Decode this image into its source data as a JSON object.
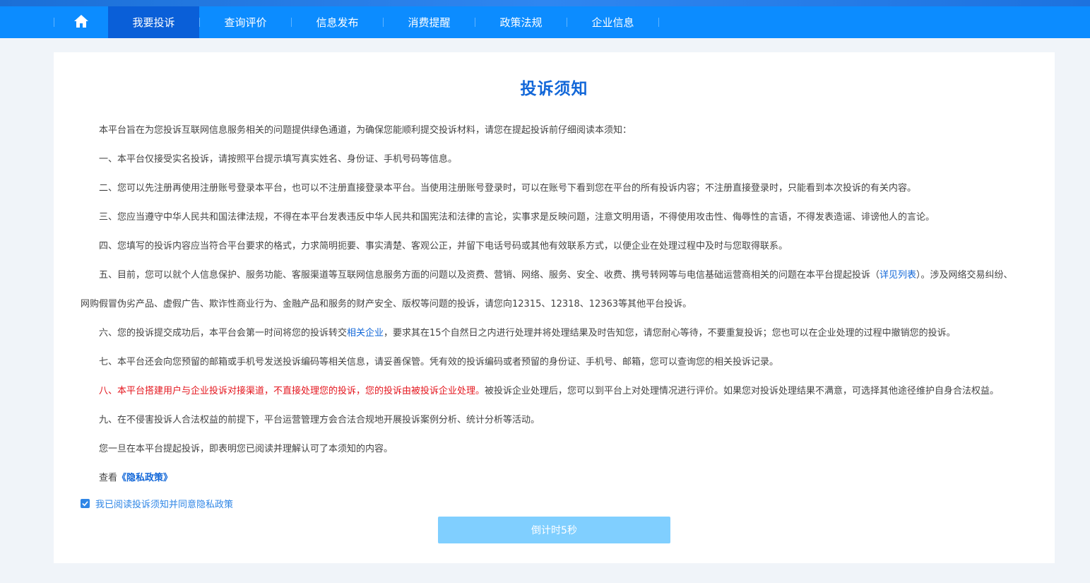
{
  "nav": {
    "home_icon": "home-icon",
    "items": [
      {
        "label": "我要投诉"
      },
      {
        "label": "查询评价"
      },
      {
        "label": "信息发布"
      },
      {
        "label": "消费提醒"
      },
      {
        "label": "政策法规"
      },
      {
        "label": "企业信息"
      }
    ]
  },
  "notice": {
    "title": "投诉须知",
    "intro": "本平台旨在为您投诉互联网信息服务相关的问题提供绿色通道，为确保您能顺利提交投诉材料，请您在提起投诉前仔细阅读本须知：",
    "p1": "一、本平台仅接受实名投诉，请按照平台提示填写真实姓名、身份证、手机号码等信息。",
    "p2": "二、您可以先注册再使用注册账号登录本平台，也可以不注册直接登录本平台。当使用注册账号登录时，可以在账号下看到您在平台的所有投诉内容；不注册直接登录时，只能看到本次投诉的有关内容。",
    "p3": "三、您应当遵守中华人民共和国法律法规，不得在本平台发表违反中华人民共和国宪法和法律的言论，实事求是反映问题，注意文明用语，不得使用攻击性、侮辱性的言语，不得发表造谣、诽谤他人的言论。",
    "p4": "四、您填写的投诉内容应当符合平台要求的格式，力求简明扼要、事实清楚、客观公正，并留下电话号码或其他有效联系方式，以便企业在处理过程中及时与您取得联系。",
    "p5_pre": "五、目前，您可以就个人信息保护、服务功能、客服渠道等互联网信息服务方面的问题以及资费、营销、网络、服务、安全、收费、携号转网等与电信基础运营商相关的问题在本平台提起投诉（",
    "p5_link": "详见列表",
    "p5_post": "）。涉及网络交易纠纷、",
    "p5_cont": "网购假冒伪劣产品、虚假广告、欺诈性商业行为、金融产品和服务的财产安全、版权等问题的投诉，请您向12315、12318、12363等其他平台投诉。",
    "p6_pre": "六、您的投诉提交成功后，本平台会第一时间将您的投诉转交",
    "p6_link": "相关企业",
    "p6_post": "，要求其在15个自然日之内进行处理并将处理结果及时告知您，请您耐心等待，不要重复投诉；您也可以在企业处理的过程中撤销您的投诉。",
    "p7": "七、本平台还会向您预留的邮箱或手机号发送投诉编码等相关信息，请妥善保管。凭有效的投诉编码或者预留的身份证、手机号、邮箱，您可以查询您的相关投诉记录。",
    "p8_pre": "八、",
    "p8_red": "本平台搭建用户与企业投诉对接渠道，不直接处理您的投诉，您的投诉由被投诉企业处理。",
    "p8_post": "被投诉企业处理后，您可以到平台上对处理情况进行评价。如果您对投诉处理结果不满意，可选择其他途径维护自身合法权益。",
    "p9": "九、在不侵害投诉人合法权益的前提下，平台运营管理方会合法合规地开展投诉案例分析、统计分析等活动。",
    "closing": "您一旦在本平台提起投诉，即表明您已阅读并理解认可了本须知的内容。",
    "privacy_pre": "查看",
    "privacy_link": "《隐私政策》"
  },
  "agree_label": "我已阅读投诉须知并同意隐私政策",
  "countdown_button": "倒计时5秒",
  "colors": {
    "nav_bg": "#0c8cff",
    "nav_active": "#0a5fd8",
    "accent": "#1267d8",
    "warning": "#e4161e",
    "button": "#80cfff"
  }
}
